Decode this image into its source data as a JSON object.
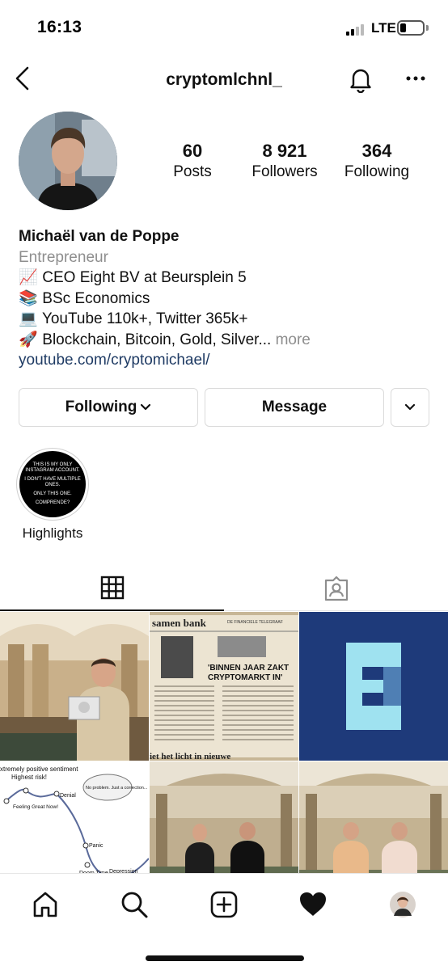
{
  "status_bar": {
    "time": "16:13",
    "network": "LTE",
    "battery_level": 0.25
  },
  "nav": {
    "username": "cryptomlchnl_"
  },
  "profile": {
    "stats": [
      {
        "value": "60",
        "label": "Posts"
      },
      {
        "value": "8 921",
        "label": "Followers"
      },
      {
        "value": "364",
        "label": "Following"
      }
    ],
    "name": "Michaël van de Poppe",
    "category": "Entrepreneur",
    "bio_lines": [
      {
        "emoji": "📈",
        "text": "CEO Eight BV at Beursplein 5"
      },
      {
        "emoji": "📚",
        "text": "BSc Economics"
      },
      {
        "emoji": "💻",
        "text": "YouTube 110k+, Twitter 365k+"
      },
      {
        "emoji": "🚀",
        "text": "Blockchain, Bitcoin, Gold, Silver..."
      }
    ],
    "more_label": "more",
    "link": "youtube.com/cryptomichael/"
  },
  "buttons": {
    "following": "Following",
    "message": "Message"
  },
  "highlight": {
    "label": "Highlights",
    "cover_lines": [
      "THIS IS MY ONLY INSTAGRAM ACCOUNT.",
      "I DON'T HAVE MULTIPLE ONES.",
      "ONLY THIS ONE.",
      "COMPRENDE?"
    ]
  },
  "grid_posts": {
    "newspaper": {
      "masthead": "samen bank",
      "paper": "DE FINANCIELE TELEGRAAF",
      "headline_1": "'BINNEN JAAR ZAKT",
      "headline_2": "CRYPTOMARKT IN'",
      "footer": "iet het licht in nieuwe"
    },
    "chart": {
      "top_label": "xtremely positive sentiment",
      "top_label_2": "Highest risk!",
      "bubble": "No problem. Just a correction...",
      "points": [
        "Feeling Great Now!",
        "Denial",
        "Panic",
        "Doom Time",
        "Depression"
      ]
    }
  },
  "colors": {
    "text": "#262626",
    "link": "#1f3b64",
    "muted": "#8e8e8e",
    "border": "#dbdbdb",
    "logo_bg": "#1e3a7a",
    "logo_fg": "#9fe2f0"
  }
}
